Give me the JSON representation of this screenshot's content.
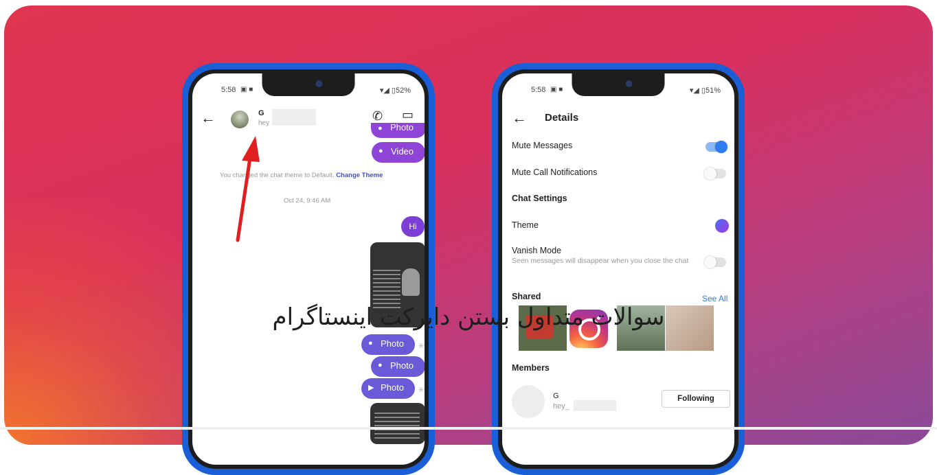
{
  "overlay_title": "سوالات متداول بستن دایرکت اینستاگرام",
  "phone_left": {
    "status": {
      "time": "5:58",
      "icons": "▣ ■",
      "battery": "▾◢ ▯52%"
    },
    "header": {
      "back": "←",
      "name": "G",
      "subtitle": "hey",
      "call_icon": "✆",
      "video_icon": "▭"
    },
    "bubbles_top": [
      {
        "label": "Photo"
      },
      {
        "label": "Video"
      }
    ],
    "system_message": "You changed the chat theme to Default.",
    "system_link": "Change Theme",
    "timestamp": "Oct 24, 9:46 AM",
    "hi": "Hi",
    "bubbles_bottom": [
      {
        "label": "Photo"
      },
      {
        "label": "Photo"
      },
      {
        "label": "Photo"
      }
    ]
  },
  "phone_right": {
    "status": {
      "time": "5:58",
      "icons": "▣ ■",
      "battery": "▾◢ ▯51%"
    },
    "header": {
      "back": "←",
      "title": "Details"
    },
    "mute_messages": {
      "label": "Mute Messages",
      "on": true
    },
    "mute_calls": {
      "label": "Mute Call Notifications",
      "on": false
    },
    "chat_settings": "Chat Settings",
    "theme": "Theme",
    "vanish": {
      "label": "Vanish Mode",
      "sub": "Seen messages will disappear when you close the chat",
      "on": false
    },
    "shared": {
      "label": "Shared",
      "see_all": "See All"
    },
    "members": {
      "label": "Members",
      "name": "G",
      "handle": "hey_",
      "follow_label": "Following"
    }
  }
}
